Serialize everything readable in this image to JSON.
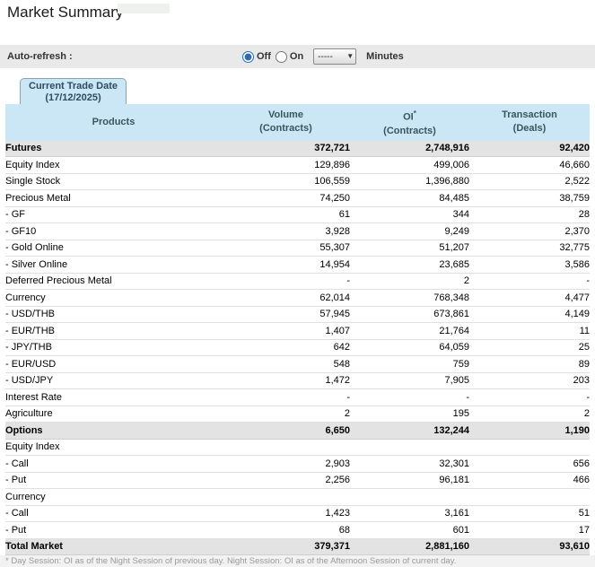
{
  "title": "Market Summary",
  "autorefresh": {
    "label": "Auto-refresh :",
    "options": [
      {
        "label": "Off",
        "selected": true
      },
      {
        "label": "On",
        "selected": false
      }
    ],
    "select_value": "-----",
    "minutes_label": "Minutes"
  },
  "tab": {
    "line1": "Current Trade Date",
    "line2": "(17/12/2025)"
  },
  "table": {
    "headers": {
      "products": "Products",
      "volume": {
        "line1": "Volume",
        "line2": "(Contracts)"
      },
      "oi": {
        "line1": "OI",
        "sup": "*",
        "line2": "(Contracts)"
      },
      "transaction": {
        "line1": "Transaction",
        "line2": "(Deals)"
      }
    },
    "rows": [
      {
        "label": "Futures",
        "style": "section",
        "volume": "372,721",
        "oi": "2,748,916",
        "transaction": "92,420"
      },
      {
        "label": "Equity Index",
        "style": "normal",
        "volume": "129,896",
        "oi": "499,006",
        "transaction": "46,660"
      },
      {
        "label": "Single Stock",
        "style": "normal",
        "volume": "106,559",
        "oi": "1,396,880",
        "transaction": "2,522"
      },
      {
        "label": "Precious Metal",
        "style": "normal",
        "volume": "74,250",
        "oi": "84,485",
        "transaction": "38,759"
      },
      {
        "label": "- GF",
        "style": "normal",
        "volume": "61",
        "oi": "344",
        "transaction": "28"
      },
      {
        "label": "- GF10",
        "style": "normal",
        "volume": "3,928",
        "oi": "9,249",
        "transaction": "2,370"
      },
      {
        "label": "- Gold Online",
        "style": "normal",
        "volume": "55,307",
        "oi": "51,207",
        "transaction": "32,775"
      },
      {
        "label": "- Silver Online",
        "style": "normal",
        "volume": "14,954",
        "oi": "23,685",
        "transaction": "3,586"
      },
      {
        "label": "Deferred Precious Metal",
        "style": "normal",
        "volume": "-",
        "oi": "2",
        "transaction": "-"
      },
      {
        "label": "Currency",
        "style": "normal",
        "volume": "62,014",
        "oi": "768,348",
        "transaction": "4,477"
      },
      {
        "label": "- USD/THB",
        "style": "normal",
        "volume": "57,945",
        "oi": "673,861",
        "transaction": "4,149"
      },
      {
        "label": "- EUR/THB",
        "style": "normal",
        "volume": "1,407",
        "oi": "21,764",
        "transaction": "11"
      },
      {
        "label": "- JPY/THB",
        "style": "normal",
        "volume": "642",
        "oi": "64,059",
        "transaction": "25"
      },
      {
        "label": "- EUR/USD",
        "style": "normal",
        "volume": "548",
        "oi": "759",
        "transaction": "89"
      },
      {
        "label": "- USD/JPY",
        "style": "normal",
        "volume": "1,472",
        "oi": "7,905",
        "transaction": "203"
      },
      {
        "label": "Interest Rate",
        "style": "normal",
        "volume": "-",
        "oi": "-",
        "transaction": "-"
      },
      {
        "label": "Agriculture",
        "style": "normal",
        "volume": "2",
        "oi": "195",
        "transaction": "2"
      },
      {
        "label": "Options",
        "style": "section",
        "volume": "6,650",
        "oi": "132,244",
        "transaction": "1,190"
      },
      {
        "label": "Equity Index",
        "style": "normal",
        "volume": "",
        "oi": "",
        "transaction": ""
      },
      {
        "label": "- Call",
        "style": "normal",
        "volume": "2,903",
        "oi": "32,301",
        "transaction": "656"
      },
      {
        "label": "- Put",
        "style": "normal",
        "volume": "2,256",
        "oi": "96,181",
        "transaction": "466"
      },
      {
        "label": "Currency",
        "style": "normal",
        "volume": "",
        "oi": "",
        "transaction": ""
      },
      {
        "label": "- Call",
        "style": "normal",
        "volume": "1,423",
        "oi": "3,161",
        "transaction": "51"
      },
      {
        "label": "- Put",
        "style": "normal",
        "volume": "68",
        "oi": "601",
        "transaction": "17"
      },
      {
        "label": "Total Market",
        "style": "section",
        "volume": "379,371",
        "oi": "2,881,160",
        "transaction": "93,610"
      }
    ]
  },
  "footnote": "* Day Session: OI as of the Night Session of previous day. Night Session: OI as of the Afternoon Session of current day.",
  "colors": {
    "header_bg": "#cbe6f4",
    "section_row_bg": "#e3e3e3",
    "refresh_bar_bg": "#e9e9e9",
    "accent_blue": "#2a6db5"
  }
}
